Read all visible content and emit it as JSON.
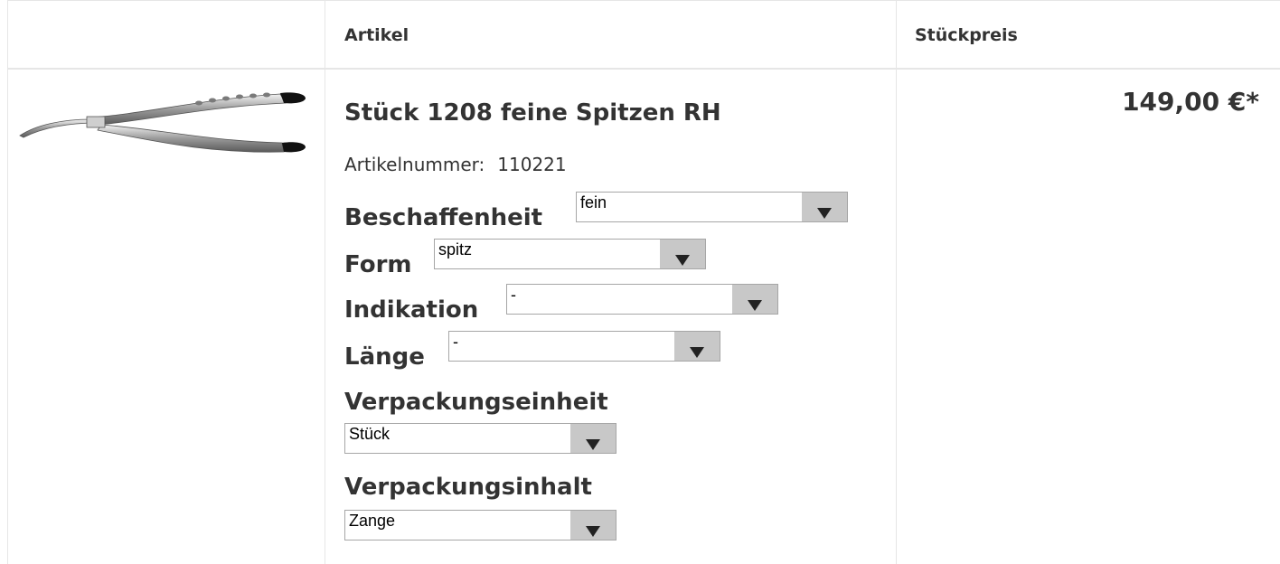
{
  "header": {
    "col_article": "Artikel",
    "col_unit_price": "Stückpreis"
  },
  "product": {
    "image_icon": "pliers-product-image",
    "title": "Stück 1208 feine Spitzen RH",
    "article_number_label": "Artikelnummer:",
    "article_number": "110221",
    "price": "149,00 €*",
    "options": {
      "beschaffenheit": {
        "label": "Beschaffenheit",
        "value": "fein"
      },
      "form": {
        "label": "Form",
        "value": "spitz"
      },
      "indikation": {
        "label": "Indikation",
        "value": "-"
      },
      "laenge": {
        "label": "Länge",
        "value": "-"
      },
      "verpackungseinheit": {
        "label": "Verpackungseinheit",
        "value": "Stück"
      },
      "verpackungsinhalt": {
        "label": "Verpackungsinhalt",
        "value": "Zange"
      }
    }
  },
  "colors": {
    "text": "#333333",
    "border": "#e6e6e6",
    "select_button": "#c8c8c8"
  }
}
